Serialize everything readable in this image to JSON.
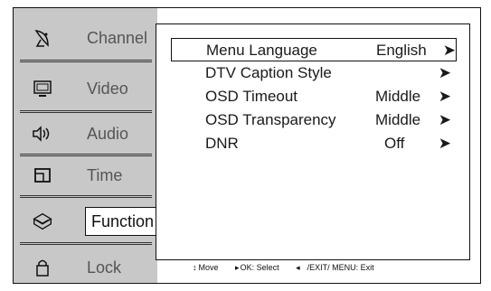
{
  "sidebar": {
    "items": [
      {
        "label": "Channel",
        "icon": "satellite-dish-icon"
      },
      {
        "label": "Video",
        "icon": "monitor-icon"
      },
      {
        "label": "Audio",
        "icon": "speaker-icon"
      },
      {
        "label": "Time",
        "icon": "clock-icon"
      },
      {
        "label": "Function",
        "icon": "function-box-icon"
      },
      {
        "label": "Lock",
        "icon": "padlock-icon"
      }
    ],
    "active": "Function"
  },
  "menu": {
    "rows": [
      {
        "name": "Menu Language",
        "value": "English",
        "arrow": "➤"
      },
      {
        "name": "DTV Caption Style",
        "value": "",
        "arrow": "➤"
      },
      {
        "name": "OSD Timeout",
        "value": "Middle",
        "arrow": "➤"
      },
      {
        "name": "OSD Transparency",
        "value": "Middle",
        "arrow": "➤"
      },
      {
        "name": "DNR",
        "value": "Off",
        "arrow": "➤"
      }
    ]
  },
  "hints": {
    "move": "Move",
    "ok": "OK: Select",
    "exit": "/EXIT/ MENU: Exit"
  }
}
